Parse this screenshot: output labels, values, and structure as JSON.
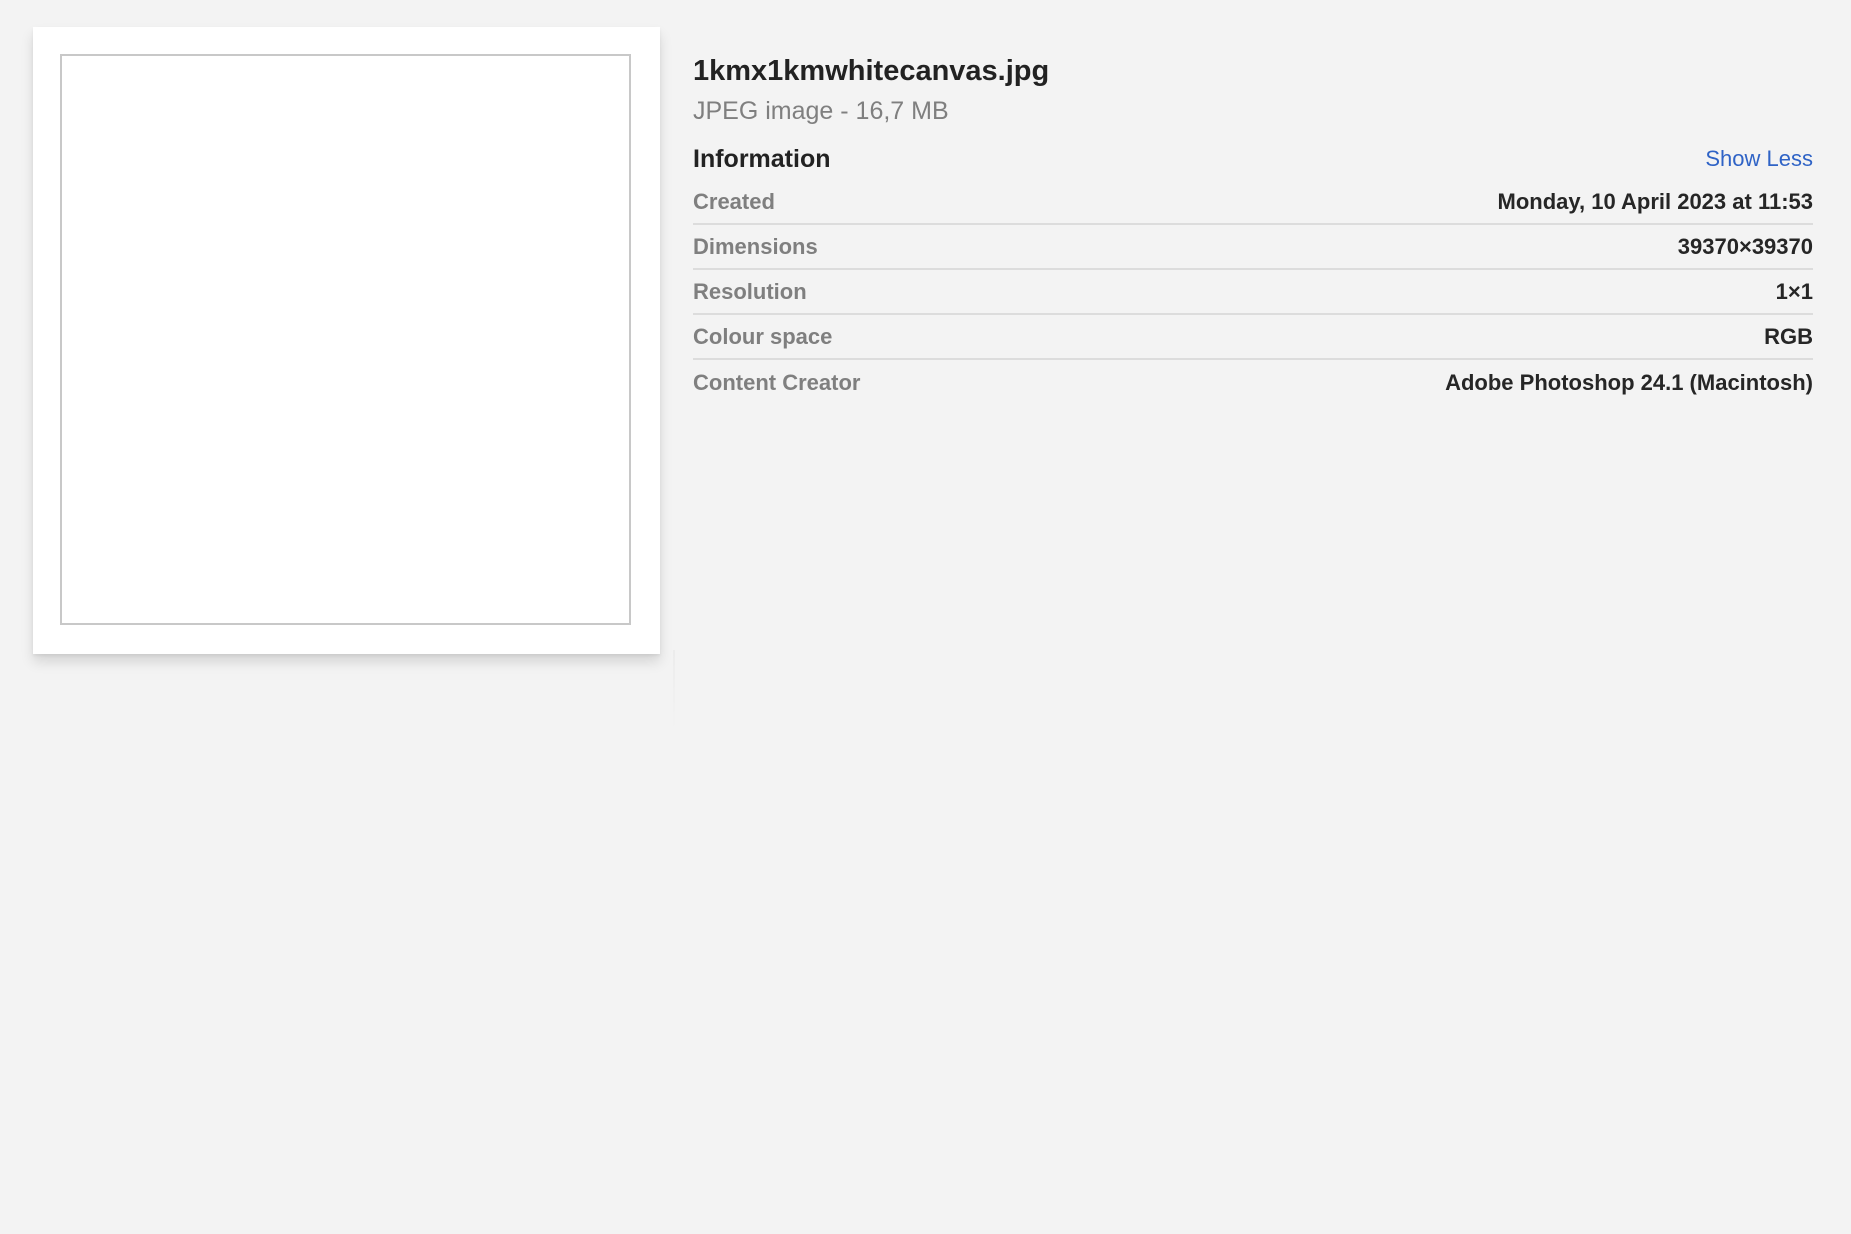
{
  "file": {
    "name": "1kmx1kmwhitecanvas.jpg",
    "kind": "JPEG image - 16,7 MB"
  },
  "information": {
    "title": "Information",
    "toggle_label": "Show Less",
    "toggle_color": "#2f63c6",
    "rows": [
      {
        "label": "Created",
        "value": "Monday, 10 April 2023 at 11:53"
      },
      {
        "label": "Dimensions",
        "value": "39370×39370"
      },
      {
        "label": "Resolution",
        "value": "1×1"
      },
      {
        "label": "Colour space",
        "value": "RGB"
      },
      {
        "label": "Content Creator",
        "value": "Adobe Photoshop 24.1 (Macintosh)"
      }
    ]
  },
  "colors": {
    "background": "#f3f3f3",
    "preview_fill": "#ffffff"
  }
}
